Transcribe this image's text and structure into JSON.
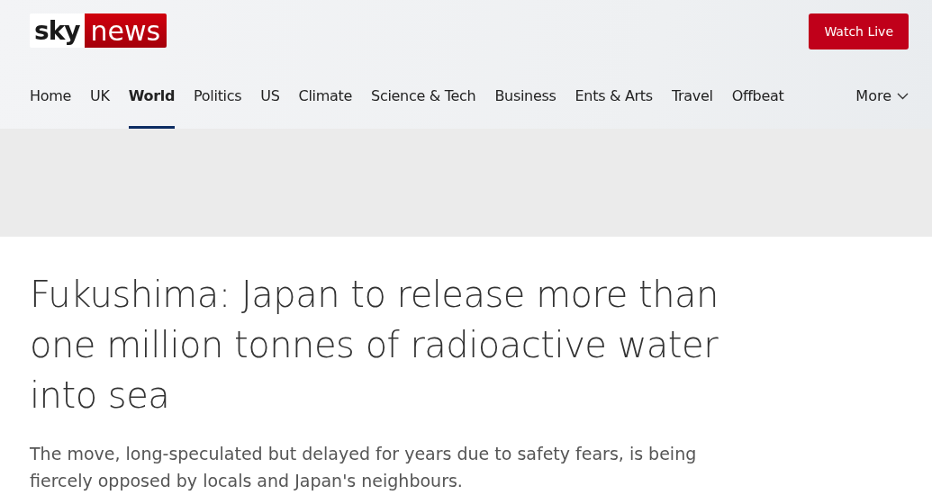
{
  "header": {
    "logo": {
      "part_1": "sky",
      "part_2": "news"
    },
    "watch_live_button": "Watch Live"
  },
  "nav": {
    "items": [
      {
        "label": "Home",
        "selected": false
      },
      {
        "label": "UK",
        "selected": false
      },
      {
        "label": "World",
        "selected": true
      },
      {
        "label": "Politics",
        "selected": false
      },
      {
        "label": "US",
        "selected": false
      },
      {
        "label": "Climate",
        "selected": false
      },
      {
        "label": "Science & Tech",
        "selected": false
      },
      {
        "label": "Business",
        "selected": false
      },
      {
        "label": "Ents & Arts",
        "selected": false
      },
      {
        "label": "Travel",
        "selected": false
      },
      {
        "label": "Offbeat",
        "selected": false
      }
    ],
    "more": "More"
  },
  "article": {
    "headline": "Fukushima: Japan to release more than one million tonnes of radioactive water into sea",
    "summary": "The move, long-speculated but delayed for years due to safety fears, is being fiercely opposed by locals and Japan's neighbours."
  }
}
